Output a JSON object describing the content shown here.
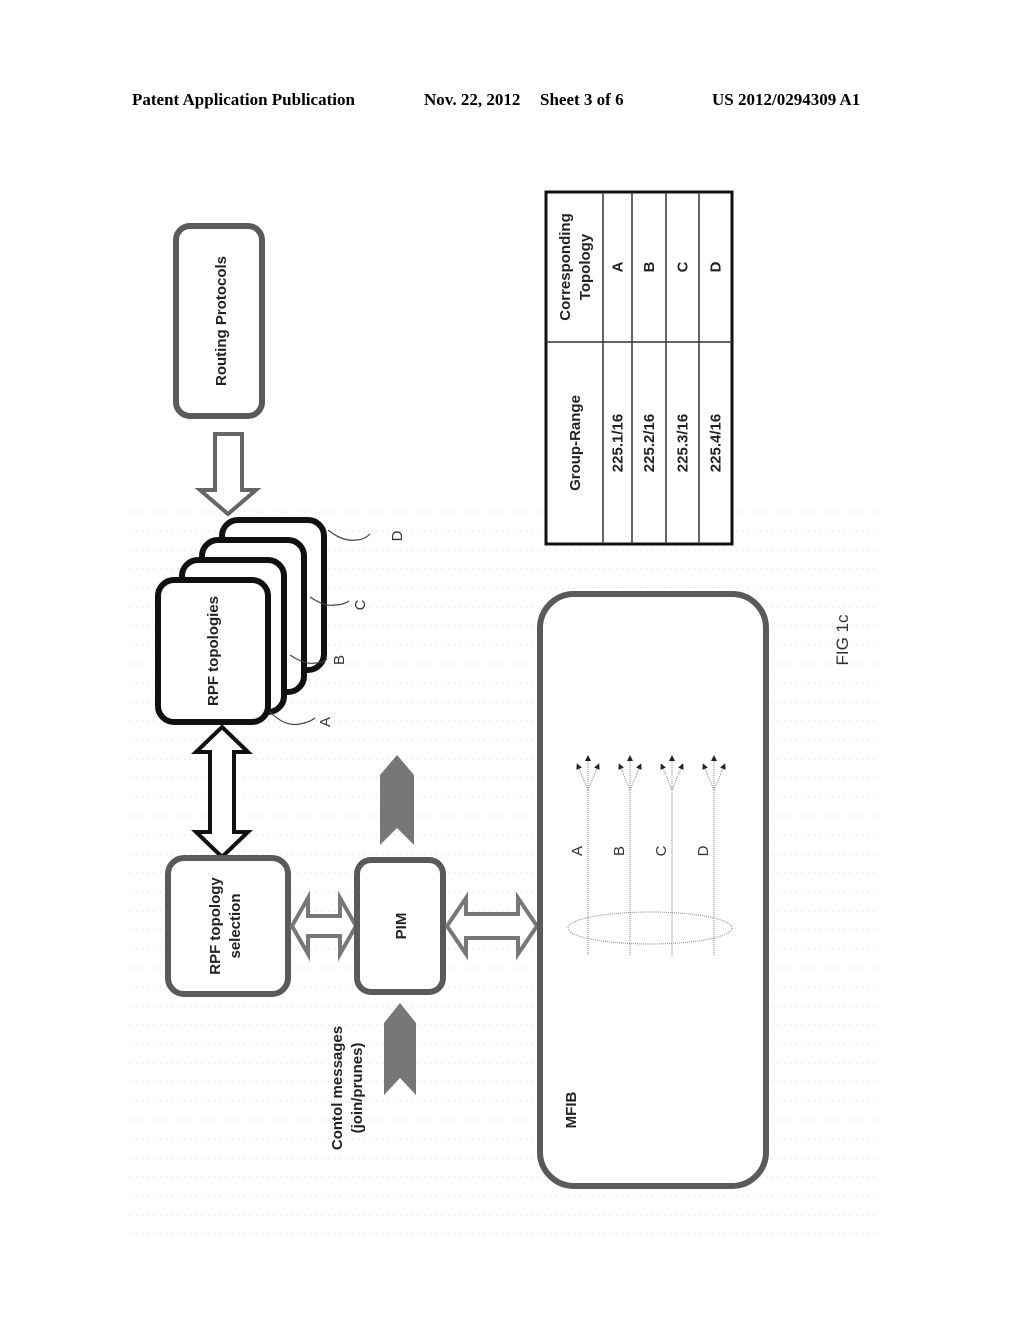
{
  "header": {
    "publication": "Patent Application Publication",
    "date": "Nov. 22, 2012",
    "sheet": "Sheet 3 of 6",
    "number": "US 2012/0294309 A1"
  },
  "figure": {
    "caption": "FIG 1c",
    "orientation": "rotated 90° counter-clockwise",
    "boxes": {
      "routing_protocols": "Routing Protocols",
      "rpf_topologies": "RPF topologies",
      "rpf_topology_selection_line1": "RPF topology",
      "rpf_topology_selection_line2": "selection",
      "pim": "PIM",
      "mfib": "MFIB"
    },
    "control_messages_line1": "Contol messages",
    "control_messages_line2": "(join/prunes)",
    "topology_refs": [
      "A",
      "B",
      "C",
      "D"
    ],
    "mfib_paths": [
      "A",
      "B",
      "C",
      "D"
    ],
    "table": {
      "headers": [
        "Group-Range",
        "Corresponding Topology"
      ],
      "header2_line1": "Corresponding",
      "header2_line2": "Topology",
      "rows": [
        [
          "225.1/16",
          "A"
        ],
        [
          "225.2/16",
          "B"
        ],
        [
          "225.3/16",
          "C"
        ],
        [
          "225.4/16",
          "D"
        ]
      ]
    }
  }
}
